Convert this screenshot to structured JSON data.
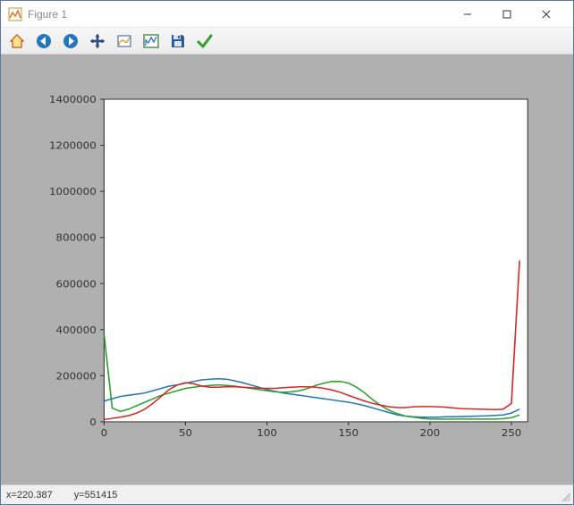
{
  "window": {
    "title": "Figure 1"
  },
  "toolbar": {
    "items": [
      {
        "name": "home-icon",
        "label": "Home"
      },
      {
        "name": "back-icon",
        "label": "Back"
      },
      {
        "name": "forward-icon",
        "label": "Forward"
      },
      {
        "name": "pan-icon",
        "label": "Pan"
      },
      {
        "name": "zoom-icon",
        "label": "Zoom"
      },
      {
        "name": "subplots-icon",
        "label": "Configure subplots"
      },
      {
        "name": "save-icon",
        "label": "Save"
      },
      {
        "name": "confirm-icon",
        "label": "Edit"
      }
    ]
  },
  "status": {
    "x_label": "x=220.387",
    "y_label": "y=551415"
  },
  "chart_data": {
    "type": "line",
    "xlabel": "",
    "ylabel": "",
    "xlim": [
      0,
      260
    ],
    "ylim": [
      0,
      1400000
    ],
    "xticks": [
      0,
      50,
      100,
      150,
      200,
      250
    ],
    "yticks": [
      0,
      200000,
      400000,
      600000,
      800000,
      1000000,
      1200000,
      1400000
    ],
    "x": [
      0,
      5,
      10,
      15,
      20,
      25,
      30,
      35,
      40,
      45,
      50,
      55,
      60,
      65,
      70,
      75,
      80,
      85,
      90,
      95,
      100,
      105,
      110,
      115,
      120,
      125,
      130,
      135,
      140,
      145,
      150,
      155,
      160,
      165,
      170,
      175,
      180,
      185,
      190,
      195,
      200,
      205,
      210,
      215,
      220,
      225,
      230,
      235,
      240,
      245,
      250,
      255
    ],
    "series": [
      {
        "name": "blue",
        "color": "#1f77b4",
        "values": [
          90000,
          100000,
          110000,
          115000,
          120000,
          125000,
          135000,
          145000,
          155000,
          160000,
          168000,
          175000,
          182000,
          185000,
          187000,
          185000,
          178000,
          170000,
          160000,
          150000,
          140000,
          132000,
          125000,
          120000,
          115000,
          110000,
          105000,
          100000,
          95000,
          90000,
          85000,
          78000,
          70000,
          60000,
          50000,
          40000,
          30000,
          25000,
          22000,
          20000,
          20000,
          20000,
          22000,
          22000,
          23000,
          24000,
          25000,
          26000,
          28000,
          30000,
          38000,
          55000
        ]
      },
      {
        "name": "green",
        "color": "#2ca02c",
        "values": [
          380000,
          60000,
          45000,
          55000,
          70000,
          85000,
          100000,
          115000,
          125000,
          135000,
          145000,
          150000,
          155000,
          158000,
          160000,
          158000,
          155000,
          150000,
          145000,
          140000,
          135000,
          130000,
          128000,
          130000,
          135000,
          145000,
          158000,
          168000,
          175000,
          175000,
          168000,
          150000,
          125000,
          95000,
          70000,
          50000,
          35000,
          25000,
          20000,
          15000,
          12000,
          12000,
          12000,
          12000,
          12000,
          12000,
          12000,
          12000,
          12000,
          14000,
          18000,
          30000
        ]
      },
      {
        "name": "red",
        "color": "#d62728",
        "values": [
          10000,
          15000,
          20000,
          27000,
          38000,
          55000,
          80000,
          110000,
          140000,
          160000,
          170000,
          165000,
          155000,
          150000,
          150000,
          152000,
          152000,
          150000,
          148000,
          146000,
          145000,
          145000,
          148000,
          150000,
          152000,
          152000,
          150000,
          145000,
          138000,
          128000,
          115000,
          102000,
          90000,
          80000,
          72000,
          65000,
          62000,
          62000,
          65000,
          66000,
          66000,
          65000,
          63000,
          60000,
          57000,
          56000,
          55000,
          54000,
          53000,
          55000,
          80000,
          700000
        ]
      }
    ]
  }
}
